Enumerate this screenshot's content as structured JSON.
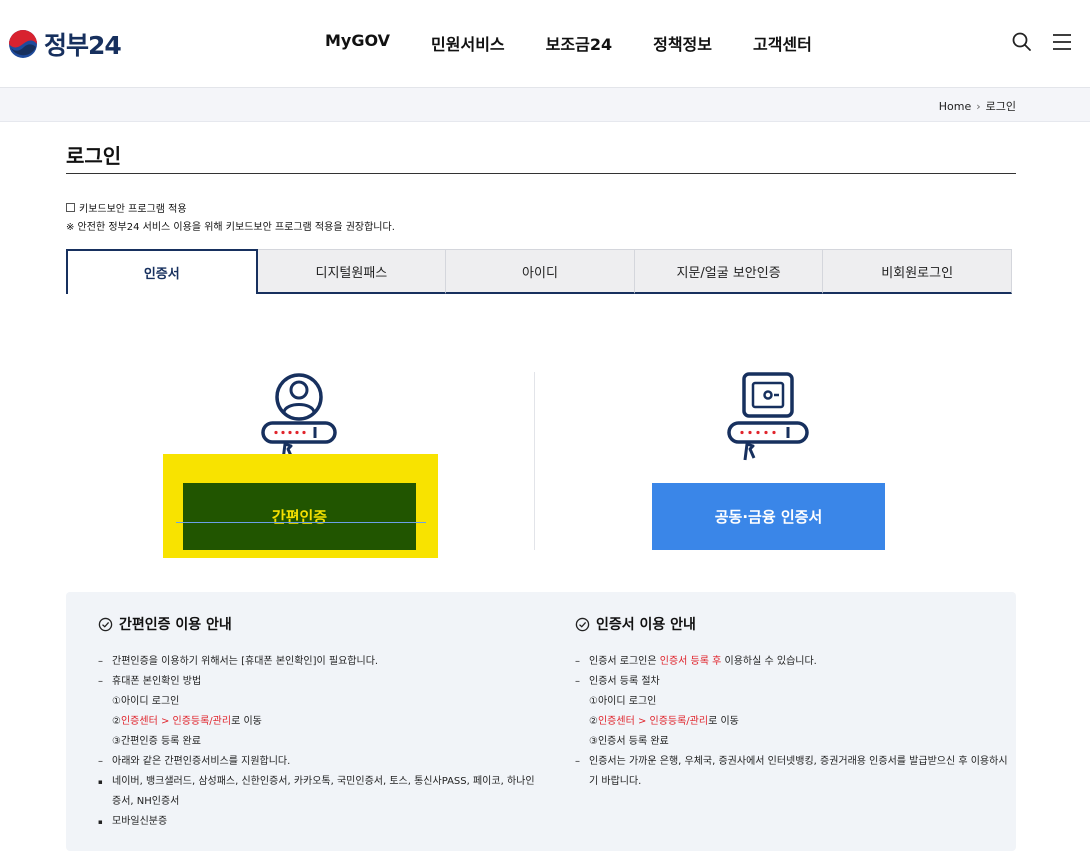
{
  "header": {
    "logo_text": "정부24",
    "nav": [
      "MyGOV",
      "민원서비스",
      "보조금24",
      "정책정보",
      "고객센터"
    ]
  },
  "breadcrumb": {
    "home": "Home",
    "sep": "›",
    "current": "로그인"
  },
  "page": {
    "title": "로그인",
    "keyboard_option": "키보드보안 프로그램 적용",
    "keyboard_note": "※ 안전한 정부24 서비스 이용을 위해 키보드보안 프로그램 적용을 권장합니다."
  },
  "tabs": [
    "인증서",
    "디지털원패스",
    "아이디",
    "지문/얼굴 보안인증",
    "비회원로그인"
  ],
  "options": {
    "easy_auth": "간편인증",
    "joint_cert": "공동·금융 인증서"
  },
  "info_easy": {
    "title": "간편인증 이용 안내",
    "line1": "간편인증을 이용하기 위해서는 [휴대폰 본인확인]이 필요합니다.",
    "line2": "휴대폰 본인확인 방법",
    "step1": "①아이디 로그인",
    "step2_prefix": "②",
    "step2_link": "인증센터 > 인증등록/관리",
    "step2_suffix": "로 이동",
    "step3": "③간편인증 등록 완료",
    "line3": "아래와 같은 간편인증서비스를 지원합니다.",
    "bullet1": "네이버, 뱅크샐러드, 삼성패스, 신한인증서, 카카오톡, 국민인증서, 토스, 통신사PASS, 페이코, 하나인증서, NH인증서",
    "bullet2": "모바일신분증"
  },
  "info_cert": {
    "title": "인증서 이용 안내",
    "line1_prefix": "인증서 로그인은 ",
    "line1_link": "인증서 등록 후",
    "line1_suffix": " 이용하실 수 있습니다.",
    "line2": "인증서 등록 절차",
    "step1": "①아이디 로그인",
    "step2_prefix": "②",
    "step2_link": "인증센터 > 인증등록/관리",
    "step2_suffix": "로 이동",
    "step3": "③인증서 등록 완료",
    "line3": "인증서는 가까운 은행, 우체국, 증권사에서 인터넷뱅킹, 증권거래용 인증서를 발급받으신 후 이용하시기 바랍니다."
  },
  "colors": {
    "navy": "#17305e",
    "highlight_yellow": "#f8e300",
    "easy_btn_green": "#215500",
    "cert_btn_blue": "#3a86e8",
    "link_red": "#e0242c"
  },
  "icons": [
    "government-logo-icon",
    "search-icon",
    "menu-icon",
    "user-card-icon",
    "safe-card-icon",
    "check-circle-icon"
  ]
}
